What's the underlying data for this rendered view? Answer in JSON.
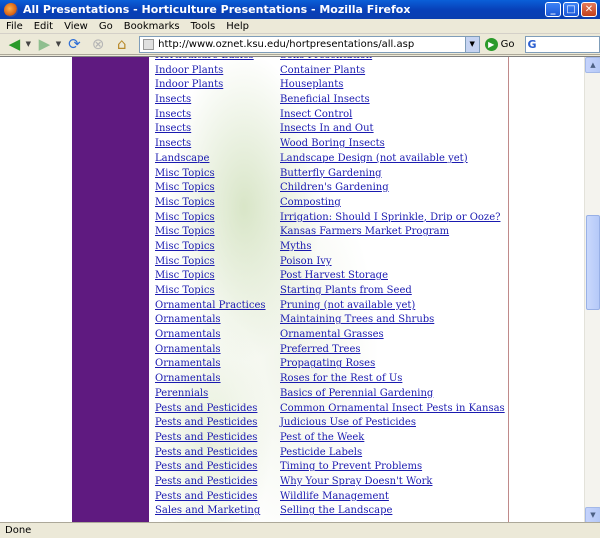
{
  "window": {
    "title": "All Presentations - Horticulture Presentations - Mozilla Firefox",
    "minimize_glyph": "_",
    "maximize_glyph": "□",
    "close_glyph": "✕"
  },
  "menu": [
    "File",
    "Edit",
    "View",
    "Go",
    "Bookmarks",
    "Tools",
    "Help"
  ],
  "toolbar": {
    "url": "http://www.oznet.ksu.edu/hortpresentations/all.asp",
    "go_label": "Go",
    "search_glyph": "G",
    "icons": [
      "back-arrow-icon",
      "forward-arrow-icon",
      "reload-icon",
      "stop-icon",
      "home-icon"
    ]
  },
  "scroll": {
    "position": 0.42,
    "visible_fraction": 0.22
  },
  "rows": [
    {
      "category": "Horticulture Basics",
      "presentation": "Soils Presentation"
    },
    {
      "category": "Indoor Plants",
      "presentation": "Container Plants"
    },
    {
      "category": "Indoor Plants",
      "presentation": "Houseplants"
    },
    {
      "category": "Insects",
      "presentation": "Beneficial Insects"
    },
    {
      "category": "Insects",
      "presentation": "Insect Control"
    },
    {
      "category": "Insects",
      "presentation": "Insects In and Out"
    },
    {
      "category": "Insects",
      "presentation": "Wood Boring Insects"
    },
    {
      "category": "Landscape",
      "presentation": "Landscape Design (not available yet)"
    },
    {
      "category": "Misc Topics",
      "presentation": "Butterfly Gardening"
    },
    {
      "category": "Misc Topics",
      "presentation": "Children's Gardening"
    },
    {
      "category": "Misc Topics",
      "presentation": "Composting"
    },
    {
      "category": "Misc Topics",
      "presentation": "Irrigation: Should I Sprinkle, Drip or Ooze?"
    },
    {
      "category": "Misc Topics",
      "presentation": "Kansas Farmers Market Program"
    },
    {
      "category": "Misc Topics",
      "presentation": "Myths"
    },
    {
      "category": "Misc Topics",
      "presentation": "Poison Ivy"
    },
    {
      "category": "Misc Topics",
      "presentation": "Post Harvest Storage"
    },
    {
      "category": "Misc Topics",
      "presentation": "Starting Plants from Seed"
    },
    {
      "category": "Ornamental Practices",
      "presentation": "Pruning (not available yet)"
    },
    {
      "category": "Ornamentals",
      "presentation": "Maintaining Trees and Shrubs"
    },
    {
      "category": "Ornamentals",
      "presentation": "Ornamental Grasses"
    },
    {
      "category": "Ornamentals",
      "presentation": "Preferred Trees"
    },
    {
      "category": "Ornamentals",
      "presentation": "Propagating Roses"
    },
    {
      "category": "Ornamentals",
      "presentation": "Roses for the Rest of Us"
    },
    {
      "category": "Perennials",
      "presentation": "Basics of Perennial Gardening"
    },
    {
      "category": "Pests and Pesticides",
      "presentation": "Common Ornamental Insect Pests in Kansas"
    },
    {
      "category": "Pests and Pesticides",
      "presentation": "Judicious Use of Pesticides"
    },
    {
      "category": "Pests and Pesticides",
      "presentation": "Pest of the Week"
    },
    {
      "category": "Pests and Pesticides",
      "presentation": "Pesticide Labels"
    },
    {
      "category": "Pests and Pesticides",
      "presentation": "Timing to Prevent Problems"
    },
    {
      "category": "Pests and Pesticides",
      "presentation": "Why Your Spray Doesn't Work"
    },
    {
      "category": "Pests and Pesticides",
      "presentation": "Wildlife Management"
    },
    {
      "category": "Sales and Marketing",
      "presentation": "Selling the Landscape"
    }
  ],
  "status": "Done",
  "colors": {
    "sidebar": "#5f1a80",
    "link": "#1a1ab0"
  }
}
